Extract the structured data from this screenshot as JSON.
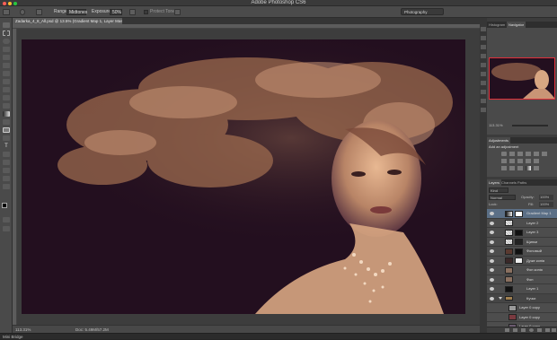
{
  "window": {
    "title": "Adobe Photoshop CS6"
  },
  "options_bar": {
    "range_label": "Range:",
    "range_value": "Midtones",
    "exposure_label": "Exposure:",
    "exposure_value": "50%",
    "protect_tones_label": "Protect Tones",
    "workspace": "Photography"
  },
  "document": {
    "tab_title": "Zadarka_4_8_All.psd @ 13.5% (Gradient Map 1, Layer Mask/8) *",
    "zoom": "113.31%",
    "doc_size": "Doc: 5.49M/57.2M"
  },
  "bottom": {
    "mini_bridge": "Mini Bridge"
  },
  "navigator": {
    "tabs": [
      "Histogram",
      "Navigator"
    ],
    "zoom": "113.31%"
  },
  "adjustments": {
    "title": "Adjustments",
    "subtitle": "Add an adjustment"
  },
  "layers_panel": {
    "tabs": [
      "Layers",
      "Channels",
      "Paths"
    ],
    "kind_label": "Kind",
    "blend_mode": "Normal",
    "opacity_label": "Opacity:",
    "opacity": "100%",
    "lock_label": "Lock:",
    "fill_label": "Fill:",
    "fill": "100%",
    "layers": [
      {
        "name": "Gradient Map 1",
        "selected": true
      },
      {
        "name": "Layer 2",
        "selected": false
      },
      {
        "name": "Layer 3",
        "selected": false
      },
      {
        "name": "Щипки",
        "selected": false
      },
      {
        "name": "Фоновый",
        "selected": false
      },
      {
        "name": "Дуже копія",
        "selected": false
      },
      {
        "name": "Фон копія",
        "selected": false
      },
      {
        "name": "Фон",
        "selected": false
      },
      {
        "name": "Layer 1",
        "selected": false
      },
      {
        "name": "Кучки",
        "selected": false
      },
      {
        "name": "Layer 0 copy",
        "selected": false
      },
      {
        "name": "Layer 0 copy",
        "selected": false
      },
      {
        "name": "Layer 0 copy",
        "selected": false
      }
    ]
  },
  "colors": {
    "ui_dark": "#262626",
    "panel": "#4a4a4a",
    "canvas_bg": "#230f1f",
    "selected_layer": "#5b6f86",
    "navigator_frame": "#e0303a"
  }
}
